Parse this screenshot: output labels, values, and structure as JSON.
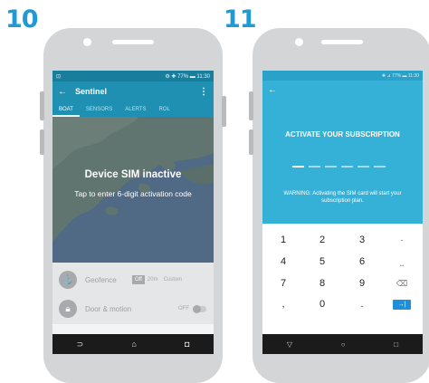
{
  "steps": {
    "first": "10",
    "second": "11"
  },
  "phone1": {
    "status_left": "⊡",
    "status_right": "⚙ ✚ 77% ▬ 11:30",
    "app_title": "Sentinel",
    "back_glyph": "←",
    "more_glyph": "⋮",
    "tabs": [
      "BOAT",
      "SENSORS",
      "ALERTS",
      "ROL"
    ],
    "map_title": "Device SIM inactive",
    "map_subtitle": "Tap to enter 6-digit activation code",
    "geofence": {
      "label": "Geofence",
      "options": [
        "Off",
        "20m",
        "Custom"
      ],
      "selected": "Off"
    },
    "door_motion": {
      "label": "Door & motion",
      "state": "OFF"
    },
    "nav": [
      "⊃",
      "⌂",
      "◘"
    ]
  },
  "phone2": {
    "status_right": "✚ ⊿ 77% ▬ 11:30",
    "back_glyph": "←",
    "title": "ACTIVATE YOUR SUBSCRIPTION",
    "code_length": 6,
    "warning": "WARNING: Activating the SIM card will start your subscription plan.",
    "keys": [
      "1",
      "2",
      "3",
      "-",
      "4",
      "5",
      "6",
      "⎵",
      "7",
      "8",
      "9",
      "⌫",
      ",",
      "0",
      ".",
      "→|"
    ],
    "nav": [
      "▽",
      "○",
      "□"
    ]
  },
  "colors": {
    "accent": "#1f9ad4",
    "appbar": "#1f8fb2",
    "activate_bg": "#35b0d6",
    "enter_key": "#1f8fd9"
  },
  "icons": {
    "geofence": "anchor-icon",
    "door": "lock-icon"
  }
}
